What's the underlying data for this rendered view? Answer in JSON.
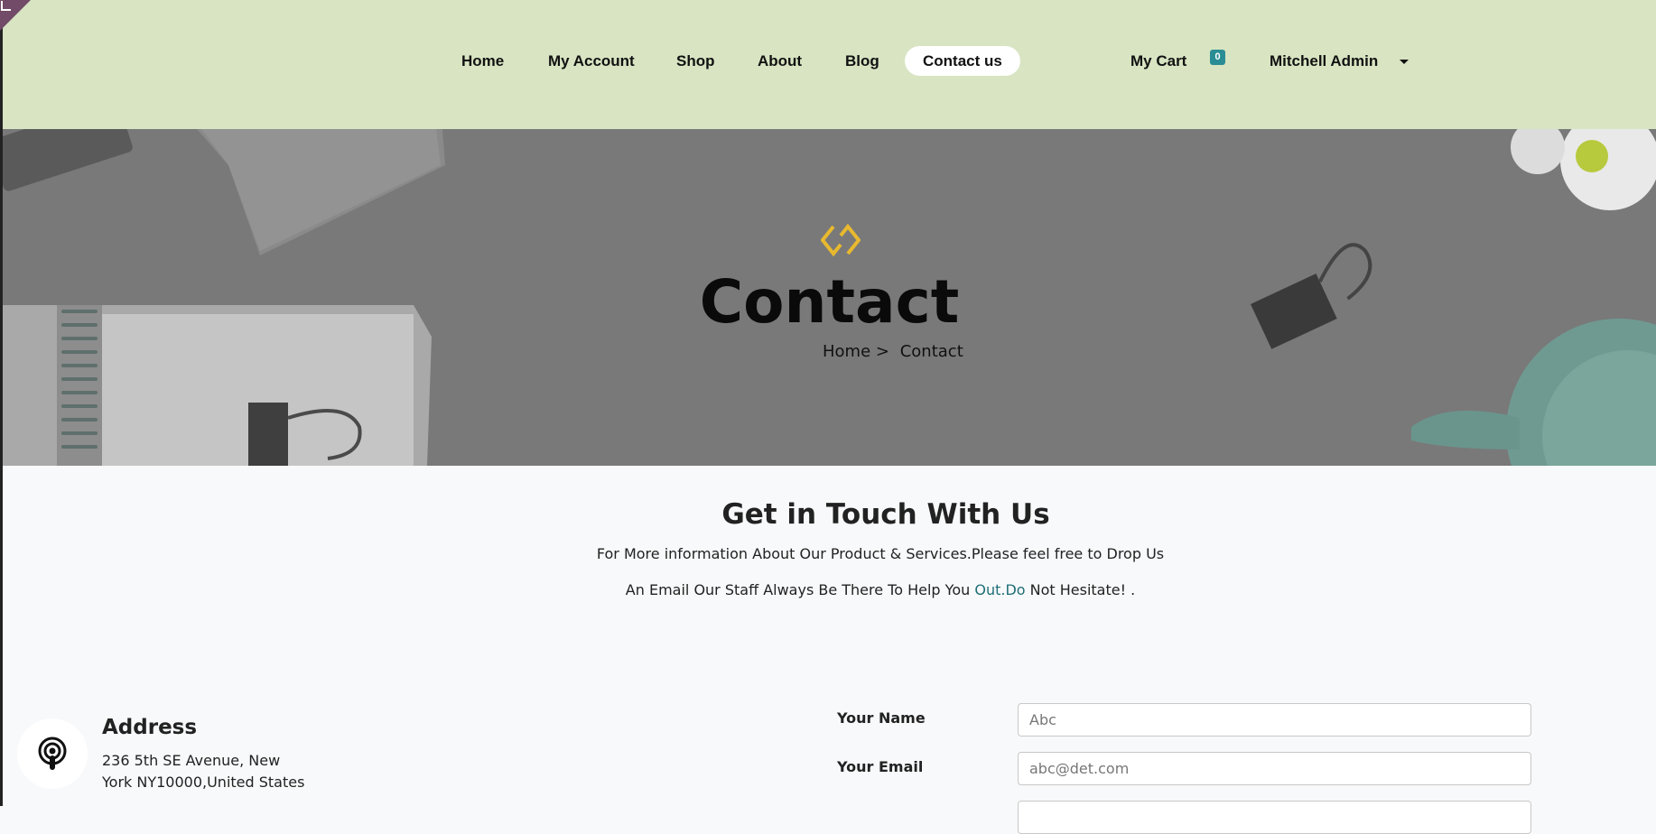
{
  "nav": {
    "items": [
      {
        "label": "Home"
      },
      {
        "label": "My Account"
      },
      {
        "label": "Shop"
      },
      {
        "label": "About"
      },
      {
        "label": "Blog"
      },
      {
        "label": "Contact us",
        "active": true
      }
    ],
    "cart_label": "My Cart",
    "cart_count": "0",
    "user_name": "Mitchell Admin"
  },
  "hero": {
    "title": "Contact",
    "breadcrumb": {
      "home": "Home",
      "separator": ">",
      "current": "Contact"
    }
  },
  "intro": {
    "title": "Get in Touch With Us",
    "line1": "For More information About Our Product & Services.Please feel free to Drop Us",
    "line2_before": "An Email Our Staff Always Be There To Help You ",
    "line2_link": "Out.Do",
    "line2_after": " Not Hesitate! ."
  },
  "address": {
    "heading": "Address",
    "line1": "236 5th SE Avenue, New",
    "line2": "York NY10000,United States",
    "icon": "podcast-icon"
  },
  "form": {
    "name_label": "Your Name",
    "name_placeholder": "Abc",
    "email_label": "Your Email",
    "email_placeholder": "abc@det.com"
  },
  "colors": {
    "header_bg": "#d8e4c2",
    "accent": "#2a8d95",
    "link": "#1f6f78",
    "icon_gold": "#e8b92f",
    "brand": "#714b67"
  }
}
